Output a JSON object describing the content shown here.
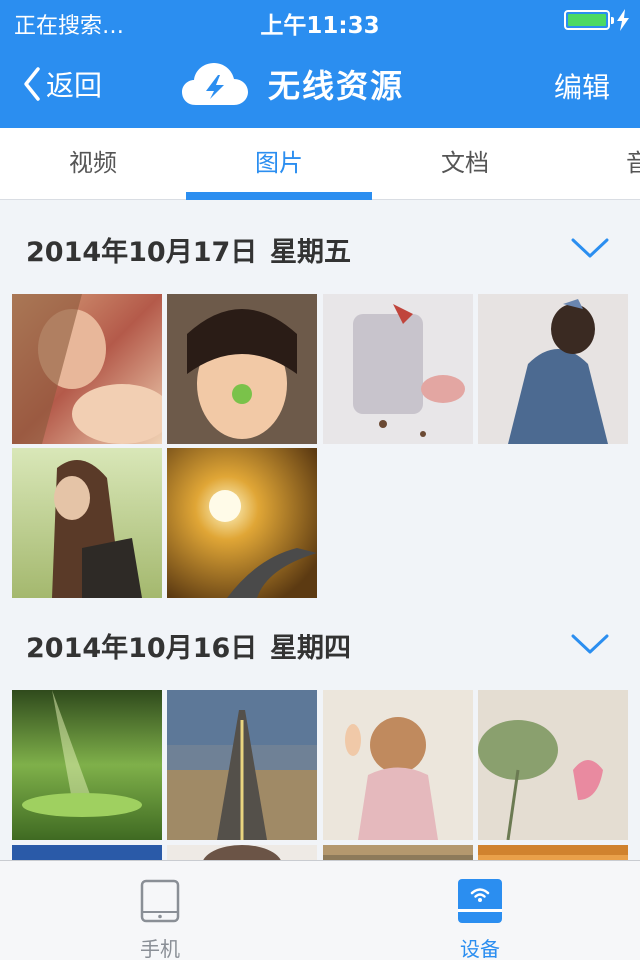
{
  "status": {
    "carrier": "正在搜索…",
    "time": "上午11:33"
  },
  "nav": {
    "back_label": "返回",
    "title": "无线资源",
    "edit_label": "编辑"
  },
  "tabs": [
    {
      "label": "视频",
      "active": false
    },
    {
      "label": "图片",
      "active": true
    },
    {
      "label": "文档",
      "active": false
    },
    {
      "label": "音",
      "active": false
    }
  ],
  "sections": [
    {
      "date": "2014年10月17日",
      "weekday": "星期五",
      "photo_count": 6
    },
    {
      "date": "2014年10月16日",
      "weekday": "星期四",
      "photo_count": 8
    }
  ],
  "tabbar": {
    "items": [
      {
        "label": "手机",
        "icon": "tablet-icon",
        "active": false
      },
      {
        "label": "设备",
        "icon": "wifi-device-icon",
        "active": true
      }
    ]
  },
  "colors": {
    "accent": "#2b8ef0",
    "battery": "#4cd964"
  }
}
